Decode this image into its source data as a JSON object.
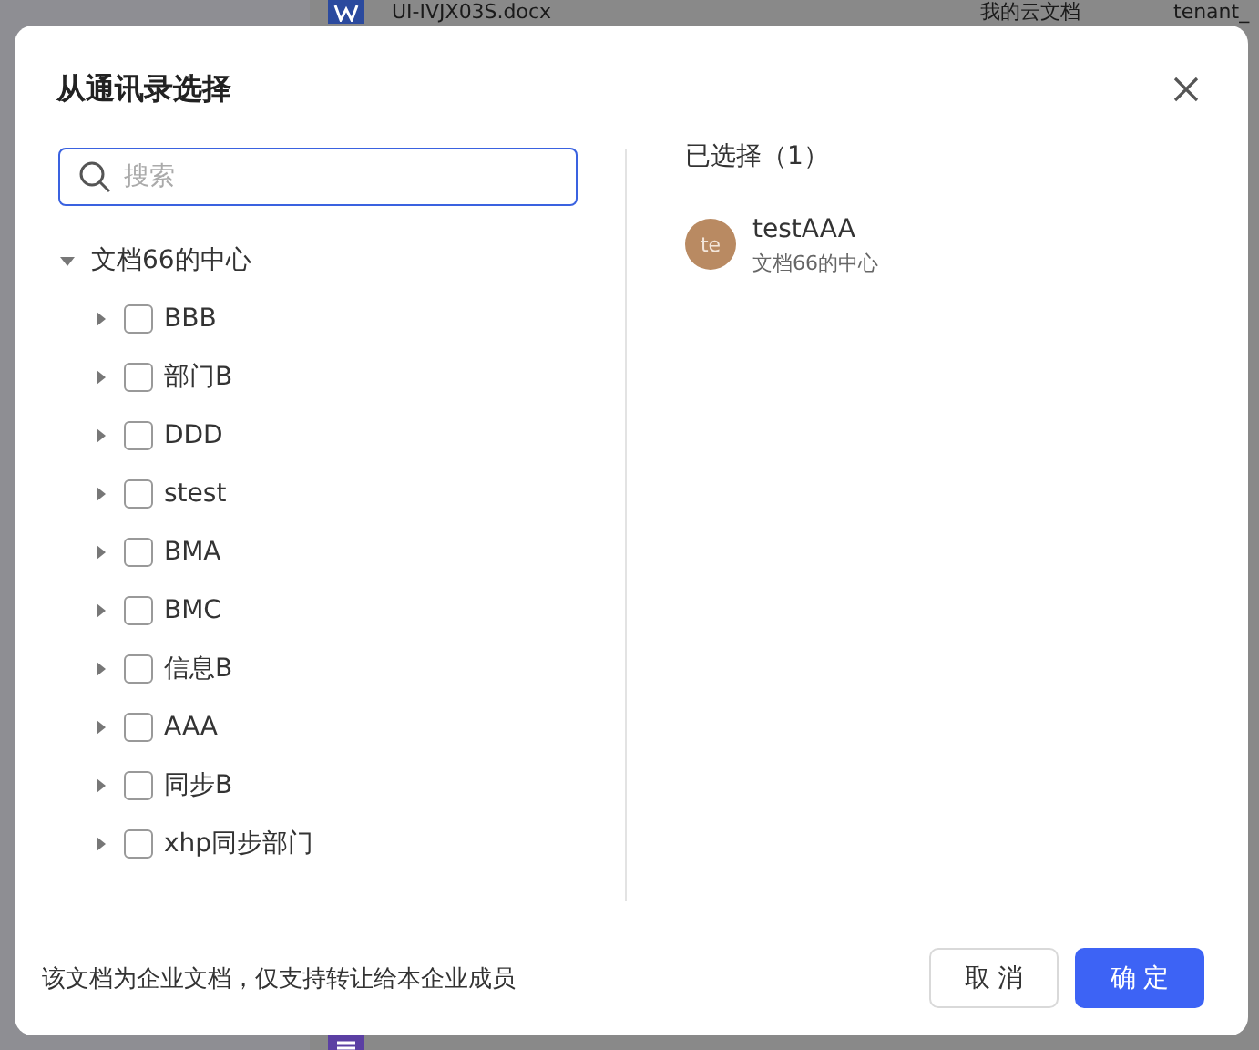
{
  "background": {
    "top_row": {
      "file_name": "UI-IVJX03S.docx",
      "location": "我的云文档",
      "owner": "tenant_"
    }
  },
  "dialog": {
    "title": "从通讯录选择",
    "search": {
      "placeholder": "搜索"
    },
    "tree": {
      "label": "文档66的中心",
      "expanded": true,
      "children": [
        {
          "label": "BBB",
          "checked": false,
          "expanded": false
        },
        {
          "label": "部门B",
          "checked": false,
          "expanded": false
        },
        {
          "label": "DDD",
          "checked": false,
          "expanded": false
        },
        {
          "label": "stest",
          "checked": false,
          "expanded": false
        },
        {
          "label": "BMA",
          "checked": false,
          "expanded": false
        },
        {
          "label": "BMC",
          "checked": false,
          "expanded": false
        },
        {
          "label": "信息B",
          "checked": false,
          "expanded": false
        },
        {
          "label": "AAA",
          "checked": false,
          "expanded": false
        },
        {
          "label": "同步B",
          "checked": false,
          "expanded": false
        },
        {
          "label": "xhp同步部门",
          "checked": false,
          "expanded": false
        }
      ]
    },
    "selected_heading": "已选择（1）",
    "selected": [
      {
        "avatar": "te",
        "name": "testAAA",
        "department": "文档66的中心",
        "color": "#b98a62"
      }
    ],
    "footer_note": "该文档为企业文档，仅支持转让给本企业成员",
    "buttons": [
      {
        "label": "取 消",
        "kind": "secondary"
      },
      {
        "label": "确 定",
        "kind": "primary"
      }
    ]
  }
}
